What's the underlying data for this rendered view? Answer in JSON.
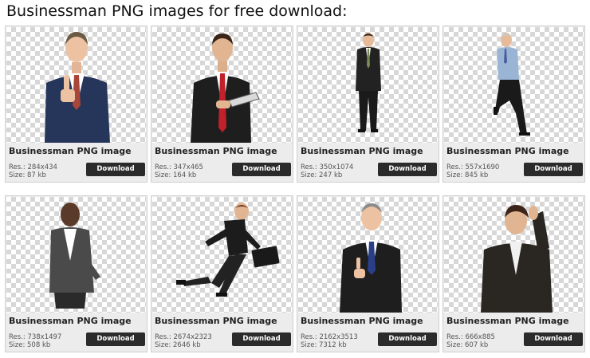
{
  "page": {
    "title": "Businessman PNG images for free download:"
  },
  "cards": [
    {
      "title": "Businessman PNG image",
      "res": "Res.: 284x434",
      "size": "Size: 87 kb",
      "button": "Download",
      "figure": "thumbs-up-businessman"
    },
    {
      "title": "Businessman PNG image",
      "res": "Res.: 347x465",
      "size": "Size: 164 kb",
      "button": "Download",
      "figure": "businessman-with-tablet"
    },
    {
      "title": "Businessman PNG image",
      "res": "Res.: 350x1074",
      "size": "Size: 247 kb",
      "button": "Download",
      "figure": "standing-businessman"
    },
    {
      "title": "Businessman PNG image",
      "res": "Res.: 557x1690",
      "size": "Size: 845 kb",
      "button": "Download",
      "figure": "leaning-businessman"
    },
    {
      "title": "Businessman PNG image",
      "res": "Res.: 738x1497",
      "size": "Size: 508 kb",
      "button": "Download",
      "figure": "businessman-in-grey-suit"
    },
    {
      "title": "Businessman PNG image",
      "res": "Res.: 2674x2323",
      "size": "Size: 2646 kb",
      "button": "Download",
      "figure": "running-businessman-with-briefcase"
    },
    {
      "title": "Businessman PNG image",
      "res": "Res.: 2162x3513",
      "size": "Size: 7312 kb",
      "button": "Download",
      "figure": "smiling-businessman-pointing"
    },
    {
      "title": "Businessman PNG image",
      "res": "Res.: 666x885",
      "size": "Size: 607 kb",
      "button": "Download",
      "figure": "stressed-businessman"
    }
  ]
}
